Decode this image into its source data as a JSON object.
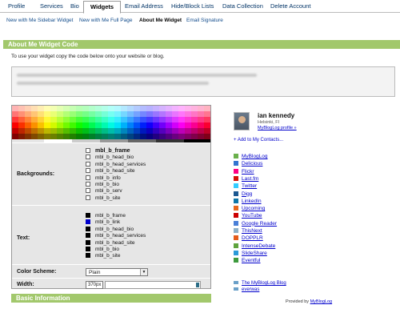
{
  "tabs": [
    "Profile",
    "Services",
    "Bio",
    "Widgets",
    "Email Address",
    "Hide/Block Lists",
    "Data Collection",
    "Delete Account"
  ],
  "active_tab": "Widgets",
  "subnav": [
    "New with Me Sidebar Widget",
    "New with Me Full Page",
    "About Me Widget",
    "Email Signature"
  ],
  "current_subnav": "About Me Widget",
  "section_title": "About Me Widget Code",
  "intro": "To use your widget copy the code below onto your website or blog.",
  "bottom_section_title": "Basic Information",
  "customize": {
    "backgrounds_label": "Backgrounds:",
    "backgrounds": [
      "mbl_b_frame",
      "mbl_b_head_bio",
      "mbl_b_head_services",
      "mbl_b_head_site",
      "mbl_b_info",
      "mbl_b_bio",
      "mbl_b_serv",
      "mbl_b_site"
    ],
    "text_label": "Text:",
    "text_items": [
      {
        "name": "mbl_b_frame",
        "color": "#000000"
      },
      {
        "name": "mbl_b_link",
        "color": "#0000cc"
      },
      {
        "name": "mbl_b_head_bio",
        "color": "#000000"
      },
      {
        "name": "mbl_b_head_services",
        "color": "#000000"
      },
      {
        "name": "mbl_b_head_site",
        "color": "#000000"
      },
      {
        "name": "mbl_b_bio",
        "color": "#000000"
      },
      {
        "name": "mbl_b_site",
        "color": "#000000"
      }
    ],
    "scheme_label": "Color Scheme:",
    "scheme_value": "Plain",
    "width_label": "Width:",
    "width_value": "370px"
  },
  "widget": {
    "name": "ian kennedy",
    "location": "Helsinki, FI",
    "profile_link": "MyBlogLog profile »",
    "add_contacts": "+ Add to My Contacts...",
    "services": [
      {
        "label": "MyBlogLog",
        "icon": "mybloglog-icon",
        "color": "#6ab04c"
      },
      {
        "label": "Delicious",
        "icon": "delicious-icon",
        "color": "#3274d0"
      },
      {
        "label": "Flickr",
        "icon": "flickr-icon",
        "color": "#ff0084"
      },
      {
        "label": "Last.fm",
        "icon": "lastfm-icon",
        "color": "#d51007"
      },
      {
        "label": "Twitter",
        "icon": "twitter-icon",
        "color": "#33ccff"
      },
      {
        "label": "Digg",
        "icon": "digg-icon",
        "color": "#1b5891"
      },
      {
        "label": "LinkedIn",
        "icon": "linkedin-icon",
        "color": "#0e76a8"
      },
      {
        "label": "Upcoming",
        "icon": "upcoming-icon",
        "color": "#e8671c"
      },
      {
        "label": "YouTube",
        "icon": "youtube-icon",
        "color": "#cc0000"
      },
      {
        "label": "Google Reader",
        "icon": "google-reader-icon",
        "color": "#4a7fd8"
      },
      {
        "label": "ThisNext",
        "icon": "thisnext-icon",
        "color": "#8bb0c8"
      },
      {
        "label": "DOPPLR",
        "icon": "dopplr-icon",
        "color": "#e45b1a"
      },
      {
        "label": "IntenseDebate",
        "icon": "intensedebate-icon",
        "color": "#5fa33c"
      },
      {
        "label": "SlideShare",
        "icon": "slideshare-icon",
        "color": "#2a9ad8"
      },
      {
        "label": "Eventful",
        "icon": "eventful-icon",
        "color": "#3d9a3d"
      }
    ],
    "footer_links": [
      "The MyBlogLog Blog",
      "everwas"
    ],
    "provided_by": "Provided by",
    "provided_link": "MyBlogLog"
  }
}
